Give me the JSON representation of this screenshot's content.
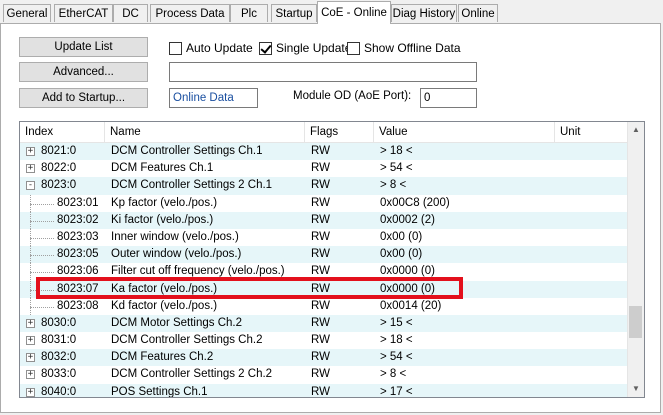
{
  "tabs": [
    {
      "label": "General",
      "active": false
    },
    {
      "label": "EtherCAT",
      "active": false
    },
    {
      "label": "DC",
      "active": false
    },
    {
      "label": "Process Data",
      "active": false
    },
    {
      "label": "Plc",
      "active": false
    },
    {
      "label": "Startup",
      "active": false
    },
    {
      "label": "CoE - Online",
      "active": true
    },
    {
      "label": "Diag History",
      "active": false
    },
    {
      "label": "Online",
      "active": false
    }
  ],
  "toolbar": {
    "update_list": "Update List",
    "advanced": "Advanced...",
    "add_to_startup": "Add to Startup...",
    "auto_update": {
      "label": "Auto Update",
      "checked": false
    },
    "single_update": {
      "label": "Single Update",
      "checked": true
    },
    "show_offline": {
      "label": "Show Offline Data",
      "checked": false
    },
    "search_value": "",
    "online_data_value": "Online Data",
    "module_od_label": "Module OD (AoE Port):",
    "module_od_value": "0"
  },
  "table": {
    "columns": [
      "Index",
      "Name",
      "Flags",
      "Value",
      "Unit"
    ],
    "rows": [
      {
        "index": "8021:0",
        "name": "DCM Controller Settings Ch.1",
        "flags": "RW",
        "value": "> 18 <",
        "unit": "",
        "expander": "+",
        "child": false
      },
      {
        "index": "8022:0",
        "name": "DCM Features Ch.1",
        "flags": "RW",
        "value": "> 54 <",
        "unit": "",
        "expander": "+",
        "child": false
      },
      {
        "index": "8023:0",
        "name": "DCM Controller Settings 2 Ch.1",
        "flags": "RW",
        "value": "> 8 <",
        "unit": "",
        "expander": "-",
        "child": false
      },
      {
        "index": "8023:01",
        "name": "Kp factor (velo./pos.)",
        "flags": "RW",
        "value": "0x00C8 (200)",
        "unit": "",
        "expander": "",
        "child": true
      },
      {
        "index": "8023:02",
        "name": "Ki factor (velo./pos.)",
        "flags": "RW",
        "value": "0x0002 (2)",
        "unit": "",
        "expander": "",
        "child": true
      },
      {
        "index": "8023:03",
        "name": "Inner window (velo./pos.)",
        "flags": "RW",
        "value": "0x00 (0)",
        "unit": "",
        "expander": "",
        "child": true
      },
      {
        "index": "8023:05",
        "name": "Outer window (velo./pos.)",
        "flags": "RW",
        "value": "0x00 (0)",
        "unit": "",
        "expander": "",
        "child": true
      },
      {
        "index": "8023:06",
        "name": "Filter cut off frequency (velo./pos.)",
        "flags": "RW",
        "value": "0x0000 (0)",
        "unit": "",
        "expander": "",
        "child": true
      },
      {
        "index": "8023:07",
        "name": "Ka factor (velo./pos.)",
        "flags": "RW",
        "value": "0x0000 (0)",
        "unit": "",
        "expander": "",
        "child": true
      },
      {
        "index": "8023:08",
        "name": "Kd factor (velo./pos.)",
        "flags": "RW",
        "value": "0x0014 (20)",
        "unit": "",
        "expander": "",
        "child": true
      },
      {
        "index": "8030:0",
        "name": "DCM Motor Settings Ch.2",
        "flags": "RW",
        "value": "> 15 <",
        "unit": "",
        "expander": "+",
        "child": false
      },
      {
        "index": "8031:0",
        "name": "DCM Controller Settings Ch.2",
        "flags": "RW",
        "value": "> 18 <",
        "unit": "",
        "expander": "+",
        "child": false
      },
      {
        "index": "8032:0",
        "name": "DCM Features Ch.2",
        "flags": "RW",
        "value": "> 54 <",
        "unit": "",
        "expander": "+",
        "child": false
      },
      {
        "index": "8033:0",
        "name": "DCM Controller Settings 2 Ch.2",
        "flags": "RW",
        "value": "> 8 <",
        "unit": "",
        "expander": "+",
        "child": false
      },
      {
        "index": "8040:0",
        "name": "POS Settings Ch.1",
        "flags": "RW",
        "value": "> 17 <",
        "unit": "",
        "expander": "+",
        "child": false
      }
    ]
  },
  "colors": {
    "highlight": "#e3101c",
    "row_alt": "#e6f6f9",
    "online_text": "#1a4fa0"
  }
}
